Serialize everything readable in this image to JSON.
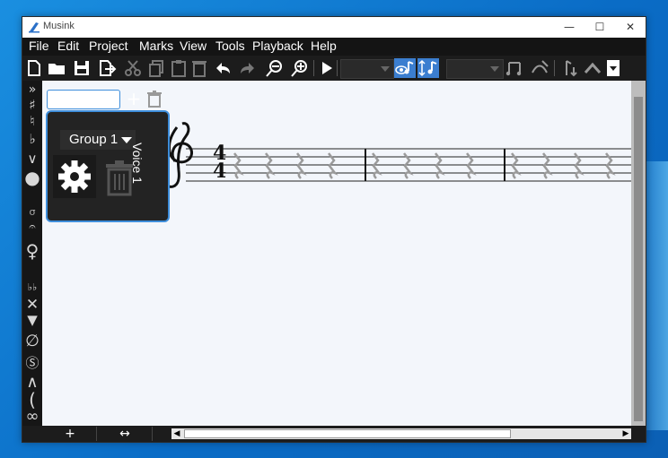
{
  "window": {
    "title": "Musink",
    "controls": {
      "minimize": "—",
      "maximize": "☐",
      "close": "✕"
    }
  },
  "menu": [
    "File",
    "Edit",
    "Project",
    "Marks",
    "View",
    "Tools",
    "Playback",
    "Help"
  ],
  "toolbar": {
    "icons": [
      "new-file-icon",
      "open-folder-icon",
      "save-icon",
      "export-icon",
      "cut-icon",
      "copy-icon",
      "paste-icon",
      "delete-icon",
      "undo-icon",
      "redo-icon",
      "zoom-out-icon",
      "zoom-in-icon",
      "play-icon",
      "voice-visibility-icon",
      "voice-swap-icon",
      "beam-icon",
      "slur-icon",
      "move-up-icon",
      "arrow-up-icon",
      "dropdown-icon"
    ],
    "combo1_value": "",
    "combo2_value": ""
  },
  "left_palette": {
    "glyphs": [
      "»",
      "♯",
      "♮",
      "♭",
      "∨",
      "●",
      "σ",
      "𝄐",
      "♀",
      "♭♭",
      "✕",
      "▼",
      "∅",
      "Ⓢ",
      "∧",
      "(",
      "∞"
    ]
  },
  "voice_panel": {
    "name_input_value": "",
    "group_label": "Group 1",
    "voice_label": "Voice 1",
    "add_icon": "plus-icon",
    "delete_icon": "trash-icon",
    "settings_icon": "gear-icon"
  },
  "staff": {
    "time_signature_top": "4",
    "time_signature_bottom": "4",
    "measures": 4,
    "rests_per_measure": 4
  },
  "bottom": {
    "add_label": "+",
    "resize_label": "↔"
  },
  "colors": {
    "accent": "#3e8edb",
    "dark_bg": "#1e1e1e",
    "canvas": "#f3f6fb"
  }
}
